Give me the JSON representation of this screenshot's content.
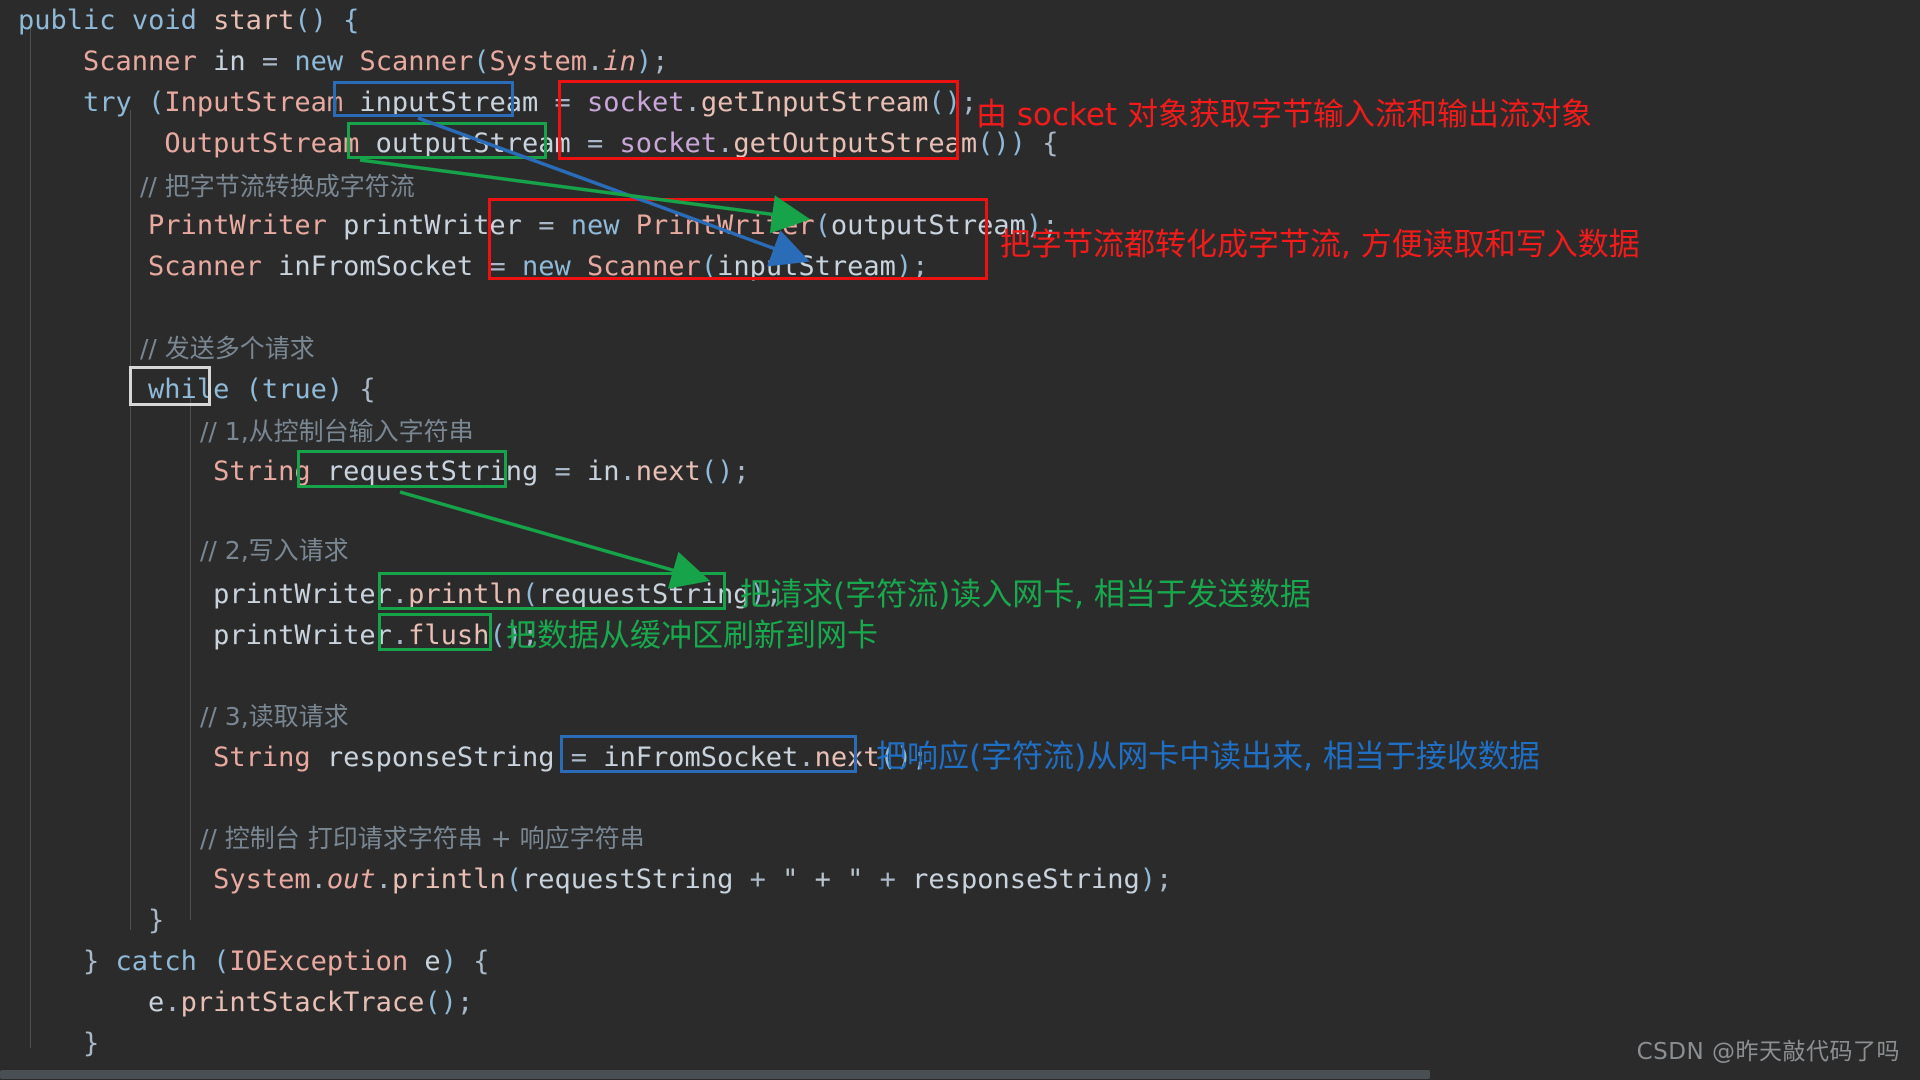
{
  "editor": {
    "background": "#2b2b2b",
    "foreground": "#a9b7c6",
    "language": "Java",
    "lines": [
      {
        "id": "l1",
        "text": "public void start() {"
      },
      {
        "id": "l2",
        "text": "    Scanner in = new Scanner(System.in);"
      },
      {
        "id": "l3",
        "text": "    try (InputStream inputStream = socket.getInputStream();"
      },
      {
        "id": "l4",
        "text": "         OutputStream outputStream = socket.getOutputStream()) {"
      },
      {
        "id": "l5",
        "text": "        // 把字节流转换成字符流"
      },
      {
        "id": "l6",
        "text": "        PrintWriter printWriter = new PrintWriter(outputStream);"
      },
      {
        "id": "l7",
        "text": "        Scanner inFromSocket = new Scanner(inputStream);"
      },
      {
        "id": "l8",
        "text": ""
      },
      {
        "id": "l9",
        "text": "        // 发送多个请求"
      },
      {
        "id": "l10",
        "text": "        while (true) {"
      },
      {
        "id": "l11",
        "text": "            // 1,从控制台输入字符串"
      },
      {
        "id": "l12",
        "text": "            String requestString = in.next();"
      },
      {
        "id": "l13",
        "text": ""
      },
      {
        "id": "l14",
        "text": "            // 2,写入请求"
      },
      {
        "id": "l15",
        "text": "            printWriter.println(requestString);"
      },
      {
        "id": "l16",
        "text": "            printWriter.flush();"
      },
      {
        "id": "l17",
        "text": ""
      },
      {
        "id": "l18",
        "text": "            // 3,读取请求"
      },
      {
        "id": "l19",
        "text": "            String responseString = inFromSocket.next();"
      },
      {
        "id": "l20",
        "text": ""
      },
      {
        "id": "l21",
        "text": "            // 控制台 打印请求字符串 + 响应字符串"
      },
      {
        "id": "l22",
        "text": "            System.out.println(requestString + \" + \" + responseString);"
      },
      {
        "id": "l23",
        "text": "        }"
      },
      {
        "id": "l24",
        "text": "    } catch (IOException e) {"
      },
      {
        "id": "l25",
        "text": "        e.printStackTrace();"
      },
      {
        "id": "l26",
        "text": "    }"
      }
    ],
    "tokens": {
      "t_public": "public",
      "t_void": "void",
      "t_start": "start",
      "t_scanner": "Scanner",
      "t_in": "in",
      "t_new": "new",
      "t_system": "System",
      "t_system_in": "in",
      "t_try": "try",
      "t_inputstream_type": "InputStream",
      "t_inputstream_var": "inputStream",
      "t_socket": "socket",
      "t_getinputstream": "getInputStream",
      "t_outputstream_type": "OutputStream",
      "t_outputstream_var": "outputStream",
      "t_getoutputstream": "getOutputStream",
      "t_printwriter_type": "PrintWriter",
      "t_printwriter_var": "printWriter",
      "t_infromsocket": "inFromSocket",
      "t_while": "while",
      "t_true": "true",
      "t_string": "String",
      "t_requeststring": "requestString",
      "t_next": "next",
      "t_println": "println",
      "t_flush": "flush",
      "t_responsestring": "responseString",
      "t_out": "out",
      "t_catch": "catch",
      "t_ioexception": "IOException",
      "t_e": "e",
      "t_printstacktrace": "printStackTrace",
      "t_plus_literal": "\" + \""
    },
    "comments": {
      "c_convert": "// 把字节流转换成字符流",
      "c_send_many": "// 发送多个请求",
      "c_step1": "// 1,从控制台输入字符串",
      "c_step2": "// 2,写入请求",
      "c_step3": "// 3,读取请求",
      "c_console": "// 控制台 打印请求字符串 + 响应字符串"
    }
  },
  "annotations": {
    "colors": {
      "red": "#ee1111",
      "green": "#17a349",
      "blue": "#2b6cb8",
      "white": "#d7d7d7"
    },
    "notes": [
      {
        "id": "note-red-1",
        "color": "#f21b1b",
        "text": "由 socket 对象获取字节输入流和输出流对象"
      },
      {
        "id": "note-red-2",
        "color": "#f21b1b",
        "text": "把字节流都转化成字节流, 方便读取和写入数据"
      },
      {
        "id": "note-green-1",
        "color": "#18a84d",
        "text": "把请求(字符流)读入网卡, 相当于发送数据"
      },
      {
        "id": "note-green-2",
        "color": "#18a84d",
        "text": "把数据从缓冲区刷新到网卡"
      },
      {
        "id": "note-blue-1",
        "color": "#1f6fc4",
        "text": "把响应(字符流)从网卡中读出来, 相当于接收数据"
      }
    ],
    "boxes": [
      {
        "id": "box-inputstream-var",
        "color": "#2b6cb8",
        "target": "inputStream"
      },
      {
        "id": "box-outputstream-var",
        "color": "#17a349",
        "target": "outputStream"
      },
      {
        "id": "box-socket-streams",
        "color": "#ee1111",
        "target": "socket.getInputStream(); socket.getOutputStream())"
      },
      {
        "id": "box-new-writers",
        "color": "#ee1111",
        "target": "new PrintWriter(outputStream); new Scanner(inputStream);"
      },
      {
        "id": "box-while-keyword",
        "color": "#d7d7d7",
        "target": "while"
      },
      {
        "id": "box-requeststring",
        "color": "#17a349",
        "target": "requestString"
      },
      {
        "id": "box-println-call",
        "color": "#17a349",
        "target": "println(requestString)"
      },
      {
        "id": "box-flush-call",
        "color": "#17a349",
        "target": "flush()"
      },
      {
        "id": "box-infromsocket-next",
        "color": "#2b6cb8",
        "target": "inFromSocket.next()"
      }
    ],
    "arrows": [
      {
        "id": "arrow-inputstream-to-scanner",
        "color": "#2b6cb8",
        "from": "inputStream",
        "to": "new Scanner(inputStream)"
      },
      {
        "id": "arrow-outputstream-to-printwriter",
        "color": "#17a349",
        "from": "outputStream",
        "to": "new PrintWriter(outputStream)"
      },
      {
        "id": "arrow-requeststring-to-println",
        "color": "#17a349",
        "from": "requestString",
        "to": "println(requestString)"
      }
    ]
  },
  "watermark": {
    "text": "CSDN @昨天敲代码了吗"
  }
}
